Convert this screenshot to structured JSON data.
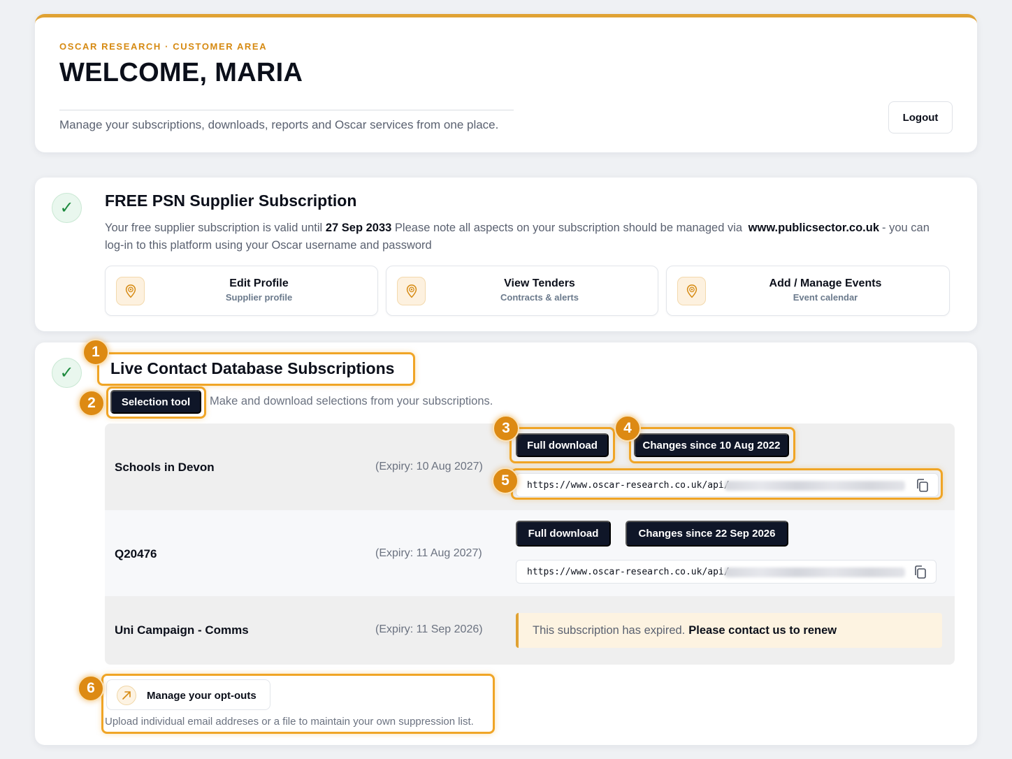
{
  "header": {
    "eyebrow": "OSCAR RESEARCH · CUSTOMER AREA",
    "title": "WELCOME, MARIA",
    "description": "Manage your subscriptions, downloads, reports and Oscar services from one place.",
    "logout_label": "Logout"
  },
  "psn": {
    "title": "FREE PSN Supplier Subscription",
    "text_before": "Your free supplier subscription is valid until",
    "valid_until": "27 Sep 2033",
    "text_middle": "Please note all aspects on your subscription should be managed via",
    "domain": "www.publicsector.co.uk",
    "text_after": "- you can log-in to this platform using your Oscar username and password",
    "tiles": [
      {
        "title": "Edit Profile",
        "subtitle": "Supplier profile",
        "icon": "location-pin-icon"
      },
      {
        "title": "View Tenders",
        "subtitle": "Contracts & alerts",
        "icon": "location-pin-icon"
      },
      {
        "title": "Add / Manage Events",
        "subtitle": "Event calendar",
        "icon": "location-pin-icon"
      }
    ]
  },
  "live": {
    "title": "Live Contact Database Subscriptions",
    "selection_tool_label": "Selection tool",
    "selection_desc": "Make and download selections from your subscriptions.",
    "subscriptions": [
      {
        "name": "Schools in Devon",
        "expiry": "(Expiry: 10 Aug 2027)",
        "full_download": "Full download",
        "changes_since": "Changes since 10 Aug 2022",
        "api_url": "https://www.oscar-research.co.uk/api/"
      },
      {
        "name": "Q20476",
        "expiry": "(Expiry: 11 Aug 2027)",
        "full_download": "Full download",
        "changes_since": "Changes since 22 Sep 2026",
        "api_url": "https://www.oscar-research.co.uk/api/"
      },
      {
        "name": "Uni Campaign - Comms",
        "expiry": "(Expiry: 11 Sep 2026)",
        "expired_text": "This subscription has expired.",
        "renew_text": "Please contact us to renew"
      }
    ],
    "optout_label": "Manage your opt-outs",
    "optout_desc": "Upload individual email addreses or a file to maintain your own suppression list."
  },
  "markers": [
    "1",
    "2",
    "3",
    "4",
    "5",
    "6"
  ],
  "colors": {
    "accent": "#e0a233",
    "highlight": "#f0a526",
    "marker": "#dd8a13",
    "button_dark": "#0f1628",
    "check_green": "#1d8a3e"
  }
}
